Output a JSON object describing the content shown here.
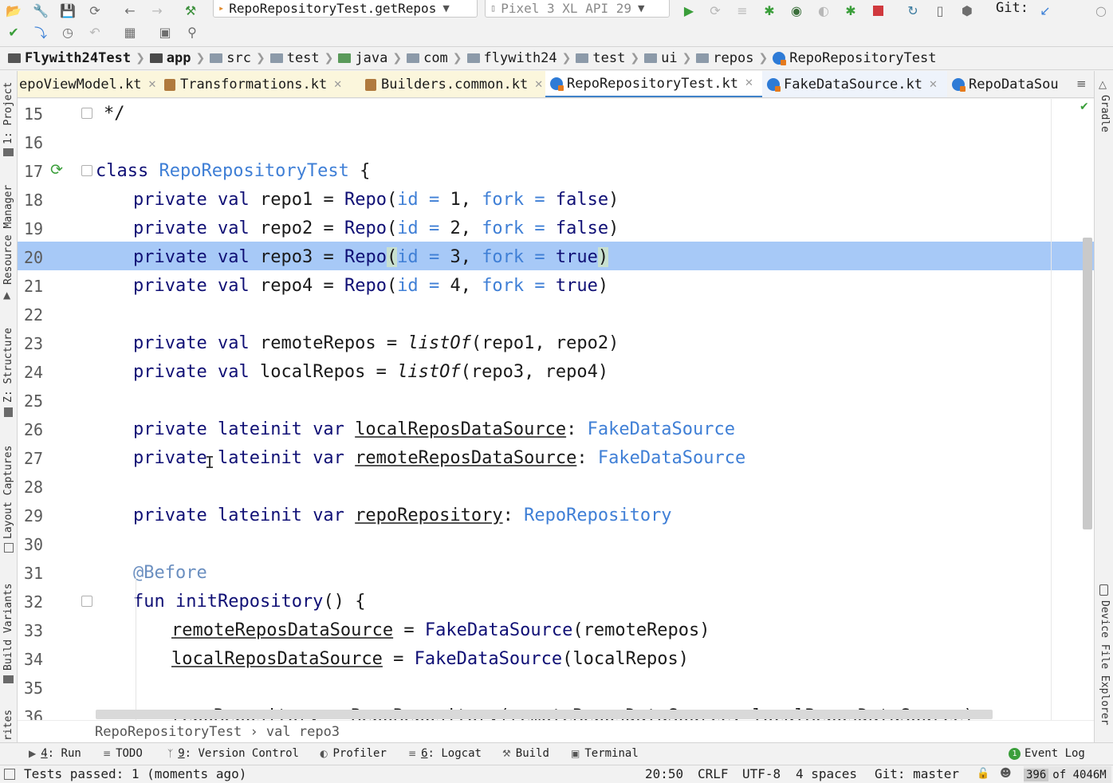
{
  "toolbar": {
    "run_config": "RepoRepositoryTest.getRepos",
    "device": "Pixel 3 XL API 29",
    "git_label": "Git:"
  },
  "navbar": {
    "crumbs": [
      "Flywith24Test",
      "app",
      "src",
      "test",
      "java",
      "com",
      "flywith24",
      "test",
      "ui",
      "repos",
      "RepoRepositoryTest"
    ]
  },
  "tabs": [
    {
      "label": "epoViewModel.kt"
    },
    {
      "label": "Transformations.kt"
    },
    {
      "label": "Builders.common.kt"
    },
    {
      "label": "RepoRepositoryTest.kt"
    },
    {
      "label": "FakeDataSource.kt"
    },
    {
      "label": "RepoDataSou"
    }
  ],
  "left_tools": [
    "1: Project",
    "Resource Manager",
    "Z: Structure",
    "Layout Captures",
    "Build Variants",
    "rites"
  ],
  "right_tools": [
    "Gradle",
    "Device File Explorer"
  ],
  "line_numbers": [
    "15",
    "16",
    "17",
    "18",
    "19",
    "20",
    "21",
    "22",
    "23",
    "24",
    "25",
    "26",
    "27",
    "28",
    "29",
    "30",
    "31",
    "32",
    "33",
    "34",
    "35",
    "36"
  ],
  "code": {
    "l15": "*/",
    "class_kw": "class",
    "class_name": "RepoRepositoryTest",
    "open_brace": "{",
    "repos": [
      {
        "name": "repo1",
        "id": "1",
        "fork": "false"
      },
      {
        "name": "repo2",
        "id": "2",
        "fork": "false"
      },
      {
        "name": "repo3",
        "id": "3",
        "fork": "true"
      },
      {
        "name": "repo4",
        "id": "4",
        "fork": "true"
      }
    ],
    "private_kw": "private",
    "val_kw": "val",
    "var_kw": "var",
    "lateinit_kw": "lateinit",
    "repo_ctor": "Repo",
    "id_param": "id",
    "fork_param": "fork",
    "remote_repos": "remoteRepos",
    "local_repos": "localRepos",
    "listof": "listOf",
    "remote_list": "repo1, repo2",
    "local_list": "repo3, repo4",
    "local_ds": "localReposDataSource",
    "remote_ds": "remoteReposDataSource",
    "fake_ds": "FakeDataSource",
    "repo_repository_var": "repoRepository",
    "repo_repository_type": "RepoRepository",
    "annotation": "@Before",
    "fun_kw": "fun",
    "fun_name": "initRepository",
    "l36": "repoRepository = RepoRepository(remoteReposDataSource, localReposDataSource)"
  },
  "editor_breadcrumb": "RepoRepositoryTest › val repo3",
  "bottom_tools": [
    {
      "num": "4",
      "label": ": Run"
    },
    {
      "num": "",
      "label": "TODO"
    },
    {
      "num": "9",
      "label": ": Version Control"
    },
    {
      "num": "",
      "label": "Profiler"
    },
    {
      "num": "6",
      "label": ": Logcat"
    },
    {
      "num": "",
      "label": "Build"
    },
    {
      "num": "",
      "label": "Terminal"
    }
  ],
  "event_log": {
    "count": "1",
    "label": "Event Log"
  },
  "status": {
    "message": "Tests passed: 1 (moments ago)",
    "position": "20:50",
    "line_sep": "CRLF",
    "encoding": "UTF-8",
    "indent": "4 spaces",
    "git": "Git: master",
    "memory_used": "396",
    "memory_of": "of 4046M"
  },
  "colors": {
    "keyword": "#101075",
    "param": "#3f7fd6",
    "selection": "#a7c9f7",
    "active_tab_underline": "#4083c9"
  }
}
